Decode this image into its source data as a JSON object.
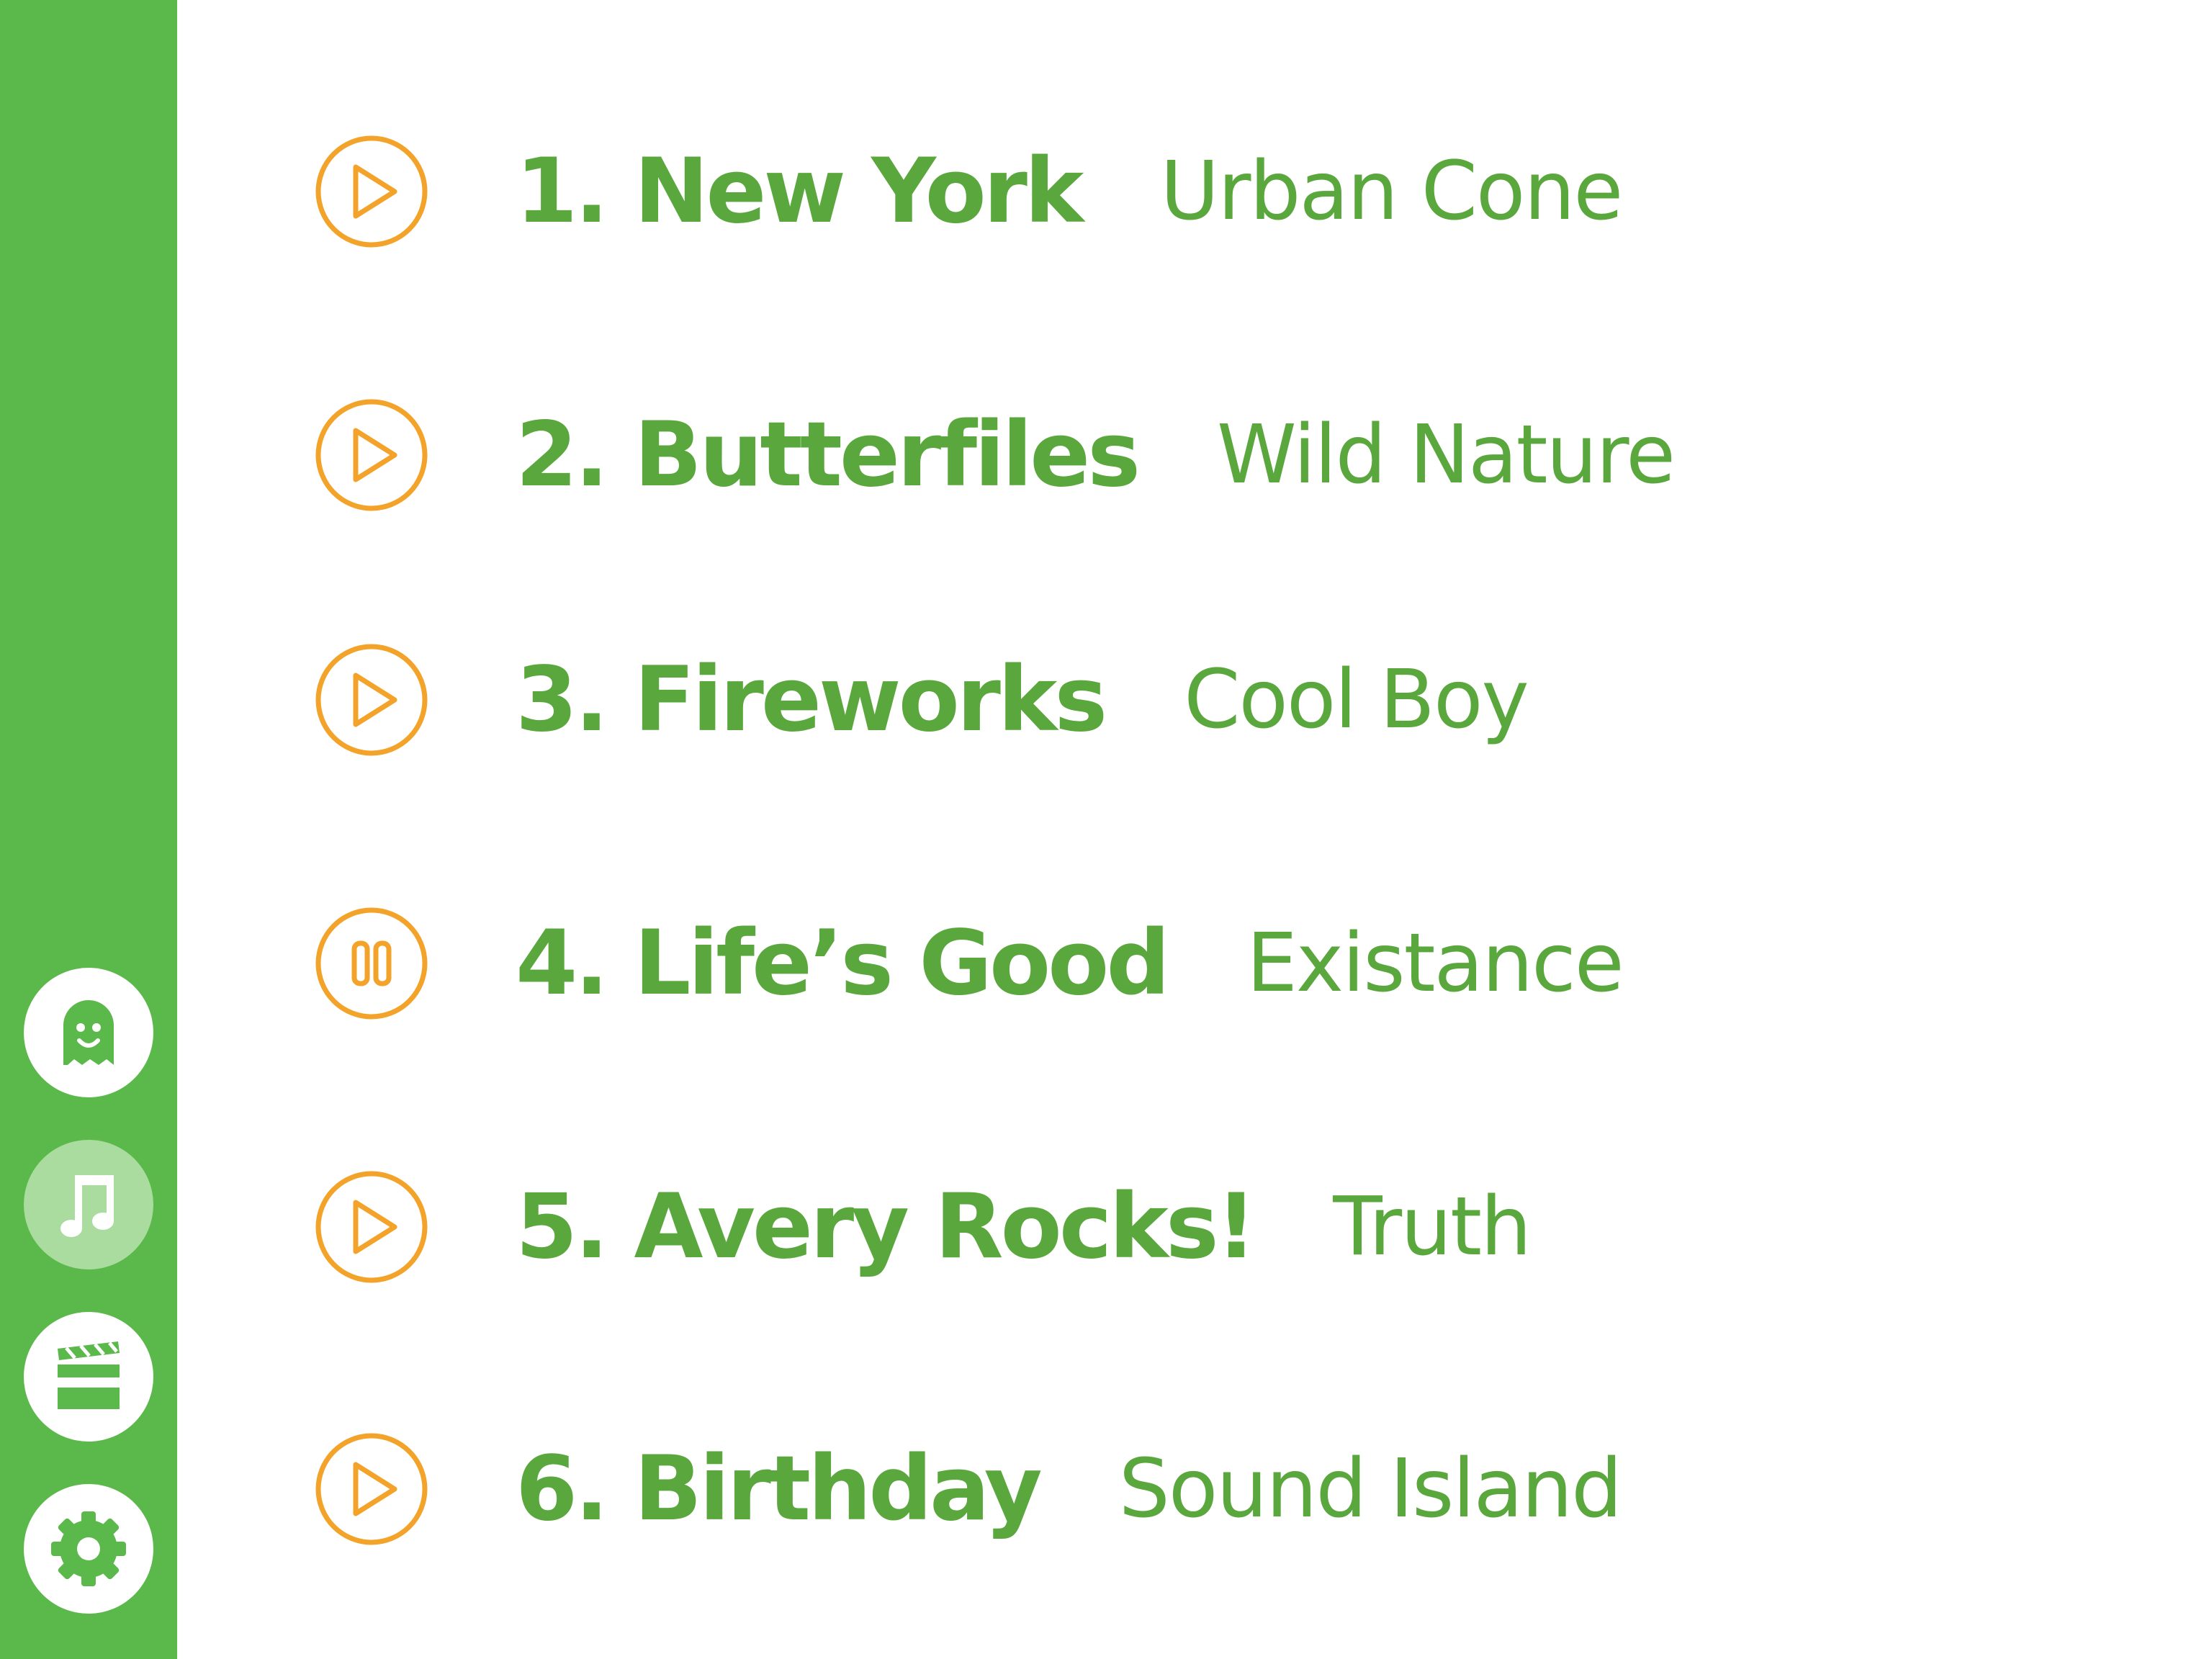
{
  "colors": {
    "sidebar_bg": "#5bb84a",
    "active_nav_bg": "#abdc9f",
    "text_green": "#5aa83d",
    "control_orange": "#f3a329"
  },
  "sidebar": {
    "items": [
      {
        "id": "ghost",
        "icon": "ghost-icon",
        "active": false
      },
      {
        "id": "music",
        "icon": "music-note-icon",
        "active": true
      },
      {
        "id": "video",
        "icon": "clapperboard-icon",
        "active": false
      },
      {
        "id": "settings",
        "icon": "gear-icon",
        "active": false
      }
    ]
  },
  "tracks": [
    {
      "title": "1. New York",
      "artist": "Urban Cone",
      "state": "play",
      "control_icon": "play-icon"
    },
    {
      "title": "2. Butterfiles",
      "artist": "Wild Nature",
      "state": "play",
      "control_icon": "play-icon"
    },
    {
      "title": "3. Fireworks",
      "artist": "Cool Boy",
      "state": "play",
      "control_icon": "play-icon"
    },
    {
      "title": "4. Life’s Good",
      "artist": "Existance",
      "state": "pause",
      "control_icon": "pause-icon"
    },
    {
      "title": "5. Avery Rocks!",
      "artist": "Truth",
      "state": "play",
      "control_icon": "play-icon"
    },
    {
      "title": "6. Birthday",
      "artist": "Sound Island",
      "state": "play",
      "control_icon": "play-icon"
    }
  ]
}
